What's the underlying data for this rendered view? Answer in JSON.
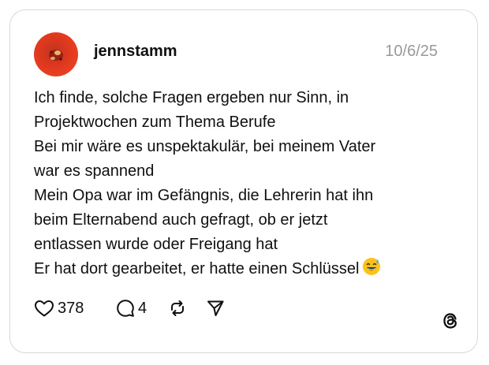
{
  "post": {
    "username": "jennstamm",
    "date": "10/6/25",
    "lines": [
      "Ich finde, solche Fragen ergeben nur Sinn, in",
      "Projektwochen zum Thema Berufe",
      "Bei mir wäre es unspektakulär, bei meinem Vater",
      "war es spannend",
      "Mein Opa war im Gefängnis, die Lehrerin hat ihn",
      "beim Elternabend auch gefragt, ob er jetzt",
      "entlassen wurde oder Freigang hat",
      "Er hat dort gearbeitet, er hatte einen Schlüssel"
    ],
    "emoji": "grinning-face-with-sweat"
  },
  "actions": {
    "likes": "378",
    "replies": "4",
    "like_icon": "heart-icon",
    "reply_icon": "comment-icon",
    "repost_icon": "repost-icon",
    "share_icon": "send-icon"
  },
  "branding": {
    "logo": "threads-logo-icon"
  },
  "colors": {
    "text": "#101010",
    "muted": "#999999",
    "border": "#d9d9d9",
    "avatar": "#e0381f"
  }
}
